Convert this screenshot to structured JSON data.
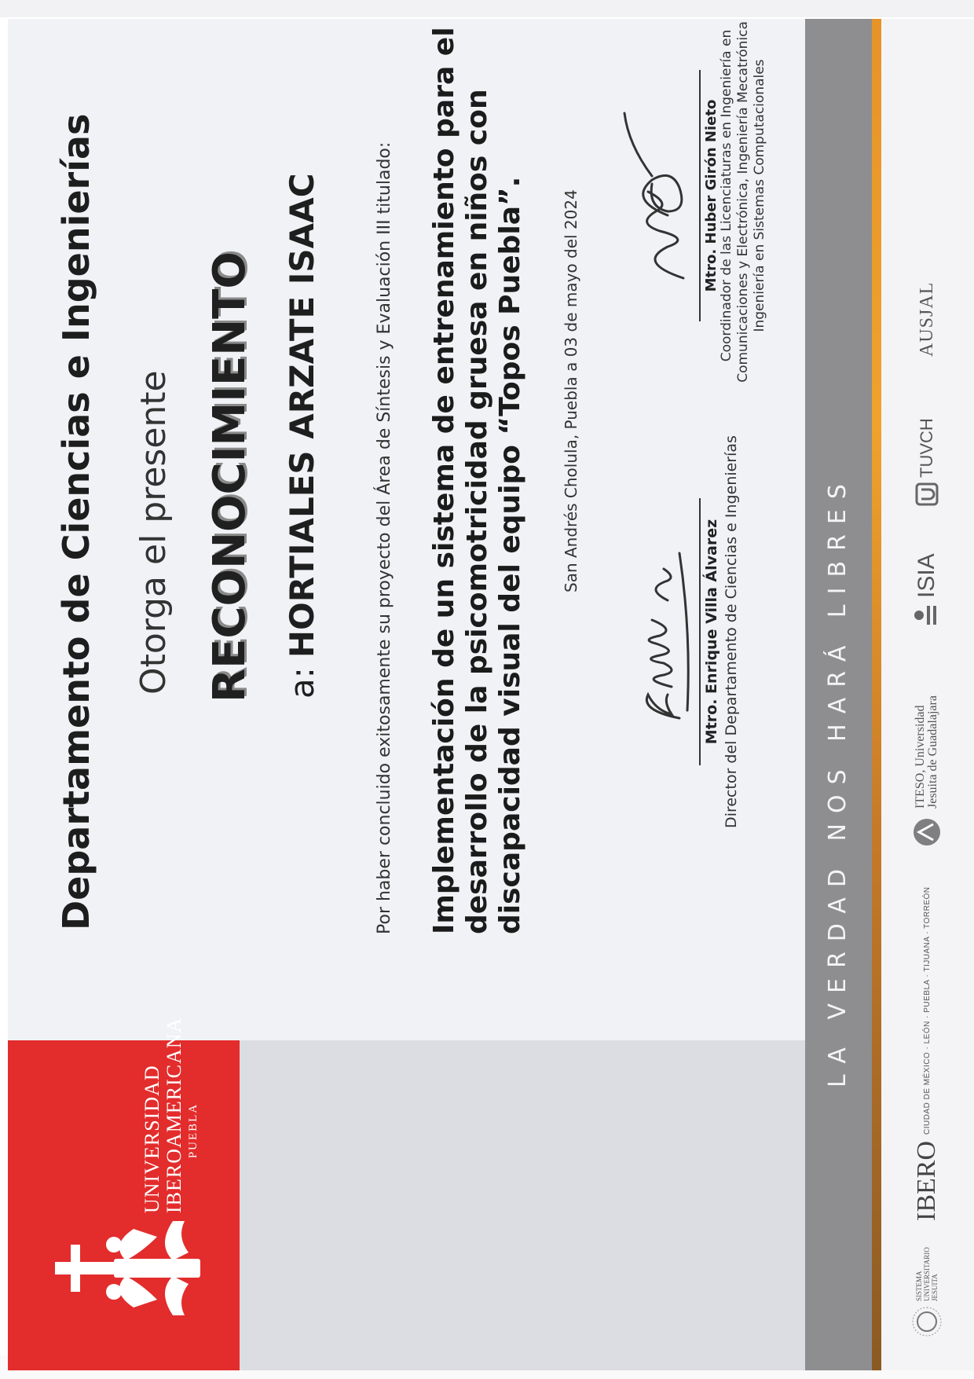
{
  "institution": {
    "line1": "UNIVERSIDAD",
    "line2": "IBEROAMERICANA",
    "line3": "PUEBLA"
  },
  "certificate": {
    "department": "Departamento de Ciencias e Ingenierías",
    "grant_text": "Otorga el presente",
    "award_title": "RECONOCIMIENTO",
    "recipient_prefix": "a:",
    "recipient_name": "HORTIALES ARZATE ISAAC",
    "intro_text": "Por haber concluido exitosamente su proyecto del Área de Síntesis y Evaluación III titulado:",
    "project_title": "Implementación de un sistema de entrenamiento para el desarrollo de la psicomotricidad gruesa en niños con discapacidad visual del equipo “Topos Puebla”.",
    "place_date": "San Andrés Cholula, Puebla a 03 de mayo del  2024"
  },
  "signatures": [
    {
      "name": "Mtro. Enrique Villa Álvarez",
      "title": "Director del Departamento de Ciencias e Ingenierías"
    },
    {
      "name": "Mtro. Huber Girón Nieto",
      "title": "Coordinador de las Licenciaturas en Ingeniería en Comunicaciones y Electrónica, Ingeniería  Mecatrónica e Ingeniería en Sistemas  Computacionales"
    }
  ],
  "motto": "LA VERDAD NOS HARÁ LIBRES",
  "footer_logos": {
    "suj": "SISTEMA UNIVERSITARIO JESUITA",
    "ibero": "IBERO",
    "ibero_cities": "CIUDAD DE MÉXICO · LEÓN · PUEBLA · TIJUANA · TORREÓN",
    "iteso_line1": "ITESO, Universidad",
    "iteso_line2": "Jesuita de Guadalajara",
    "isia": "ISIA",
    "tuvch": "TUVCH",
    "ausjal": "AUSJAL"
  },
  "colors": {
    "red_panel": "#e32c2c",
    "gray_band": "#8e8e90",
    "orange_stripe": "#f0a22c",
    "background": "#f1f2f6"
  }
}
